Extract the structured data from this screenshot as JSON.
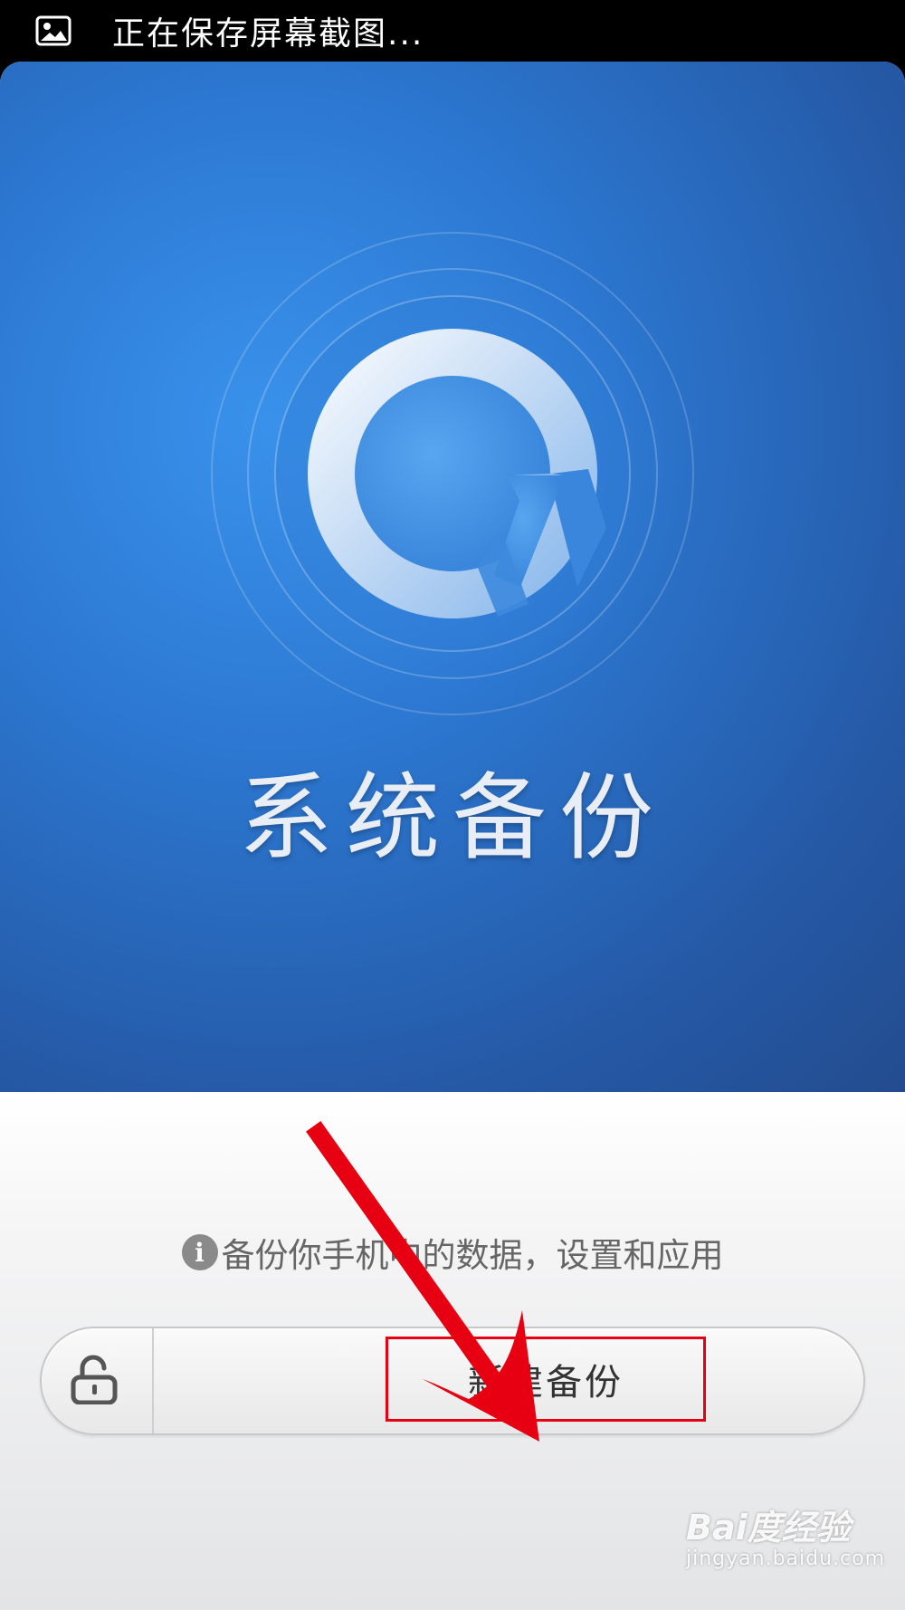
{
  "status_bar": {
    "notification_icon": "image-icon",
    "text": "正在保存屏幕截图..."
  },
  "hero": {
    "logo_icon": "backup-logo-icon",
    "title": "系统备份",
    "colors": {
      "background_light": "#3a93ec",
      "background_dark": "#234c8f"
    }
  },
  "info": {
    "icon": "info-icon",
    "icon_glyph": "i",
    "text": "备份你手机中的数据，设置和应用"
  },
  "action_bar": {
    "lock_icon": "unlock-icon",
    "new_backup_label": "新建备份"
  },
  "annotation": {
    "arrow_color": "#e60012",
    "highlight_color": "#e60012"
  },
  "watermark": {
    "brand": "Bai度经验",
    "url": "jingyan.baidu.com"
  }
}
